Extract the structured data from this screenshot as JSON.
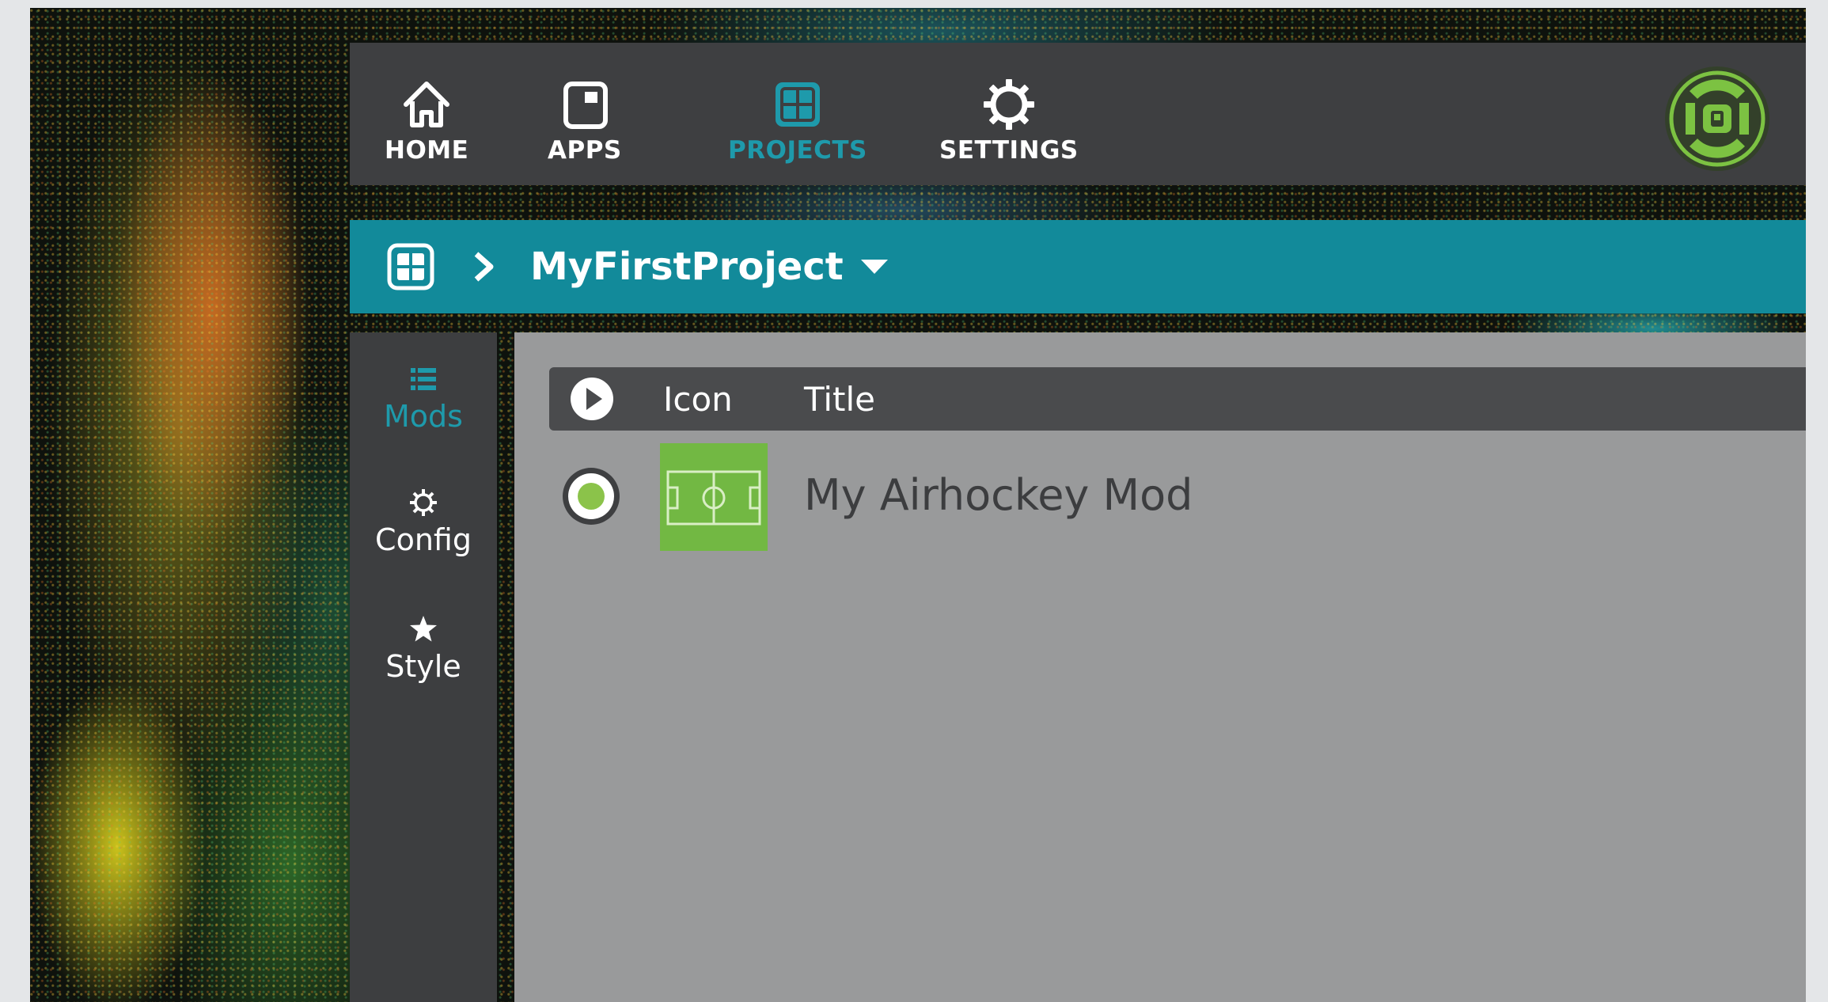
{
  "colors": {
    "accent": "#1e9aab",
    "project_bar": "#128a9a",
    "nav_background": "#3e3f41",
    "content_background": "#999a9b",
    "mod_thumbnail": "#72b843",
    "radio_selected": "#8bc34a",
    "brand_logo": "#7cc242"
  },
  "topnav": {
    "items": [
      {
        "label": "HOME",
        "icon": "home-icon",
        "active": false
      },
      {
        "label": "APPS",
        "icon": "app-window-icon",
        "active": false
      },
      {
        "label": "PROJECTS",
        "icon": "grid-icon",
        "active": true
      },
      {
        "label": "SETTINGS",
        "icon": "gear-icon",
        "active": false
      }
    ],
    "brand_icon": "brand-logo-icon"
  },
  "breadcrumb": {
    "home_icon": "grid-icon",
    "separator_icon": "chevron-right-icon",
    "project_name": "MyFirstProject",
    "dropdown_icon": "caret-down-icon"
  },
  "sidetabs": {
    "items": [
      {
        "label": "Mods",
        "icon": "list-icon",
        "active": true
      },
      {
        "label": "Config",
        "icon": "gear-icon",
        "active": false
      },
      {
        "label": "Style",
        "icon": "star-icon",
        "active": false
      }
    ]
  },
  "mods_table": {
    "header_icon": "play-icon",
    "columns": [
      "Icon",
      "Title"
    ],
    "rows": [
      {
        "title": "My Airhockey Mod",
        "selected": true,
        "thumbnail_icon": "playing-field-icon"
      }
    ]
  }
}
